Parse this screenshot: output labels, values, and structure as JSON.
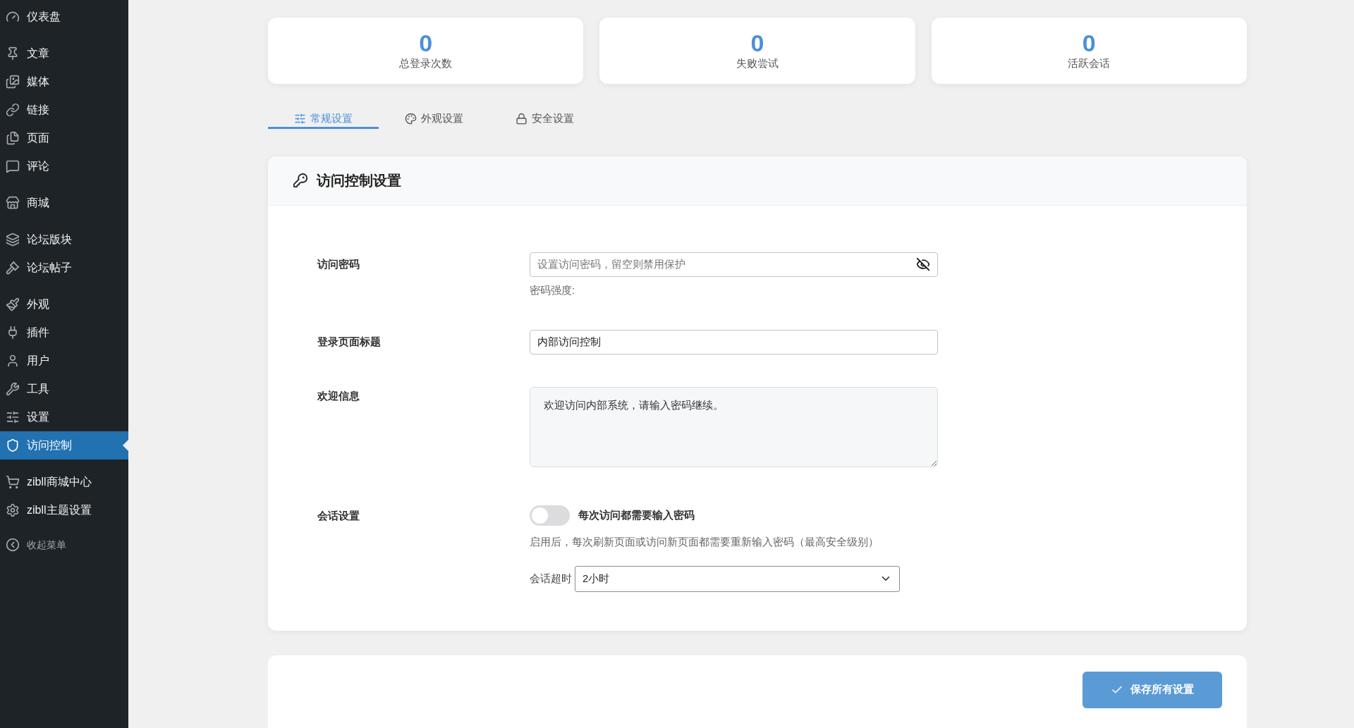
{
  "sidebar": {
    "groups": [
      [
        {
          "label": "仪表盘",
          "selected": false
        }
      ],
      [
        {
          "label": "文章",
          "selected": false
        },
        {
          "label": "媒体",
          "selected": false
        },
        {
          "label": "链接",
          "selected": false
        },
        {
          "label": "页面",
          "selected": false
        },
        {
          "label": "评论",
          "selected": false
        }
      ],
      [
        {
          "label": "商城",
          "selected": false
        }
      ],
      [
        {
          "label": "论坛版块",
          "selected": false
        },
        {
          "label": "论坛帖子",
          "selected": false
        }
      ],
      [
        {
          "label": "外观",
          "selected": false
        },
        {
          "label": "插件",
          "selected": false
        },
        {
          "label": "用户",
          "selected": false
        },
        {
          "label": "工具",
          "selected": false
        },
        {
          "label": "设置",
          "selected": false
        },
        {
          "label": "访问控制",
          "selected": true
        }
      ],
      [
        {
          "label": "zibll商城中心",
          "selected": false
        },
        {
          "label": "zibll主题设置",
          "selected": false
        }
      ]
    ],
    "collapse": "收起菜单"
  },
  "stats": [
    {
      "value": "0",
      "label": "总登录次数"
    },
    {
      "value": "0",
      "label": "失败尝试"
    },
    {
      "value": "0",
      "label": "活跃会话"
    }
  ],
  "tabs": [
    {
      "label": "常规设置",
      "selected": true
    },
    {
      "label": "外观设置",
      "selected": false
    },
    {
      "label": "安全设置",
      "selected": false
    }
  ],
  "panel": {
    "title": "访问控制设置",
    "password": {
      "label": "访问密码",
      "placeholder": "设置访问密码，留空则禁用保护",
      "strength_label": "密码强度:"
    },
    "login_title": {
      "label": "登录页面标题",
      "value": "内部访问控制"
    },
    "welcome": {
      "label": "欢迎信息",
      "value": "欢迎访问内部系统，请输入密码继续。"
    },
    "session": {
      "label": "会话设置",
      "toggle_label": "每次访问都需要输入密码",
      "on": false,
      "help": "启用后，每次刷新页面或访问新页面都需要重新输入密码（最高安全级别）",
      "timeout_label": "会话超时",
      "timeout_value": "2小时"
    }
  },
  "save_button": "保存所有设置"
}
